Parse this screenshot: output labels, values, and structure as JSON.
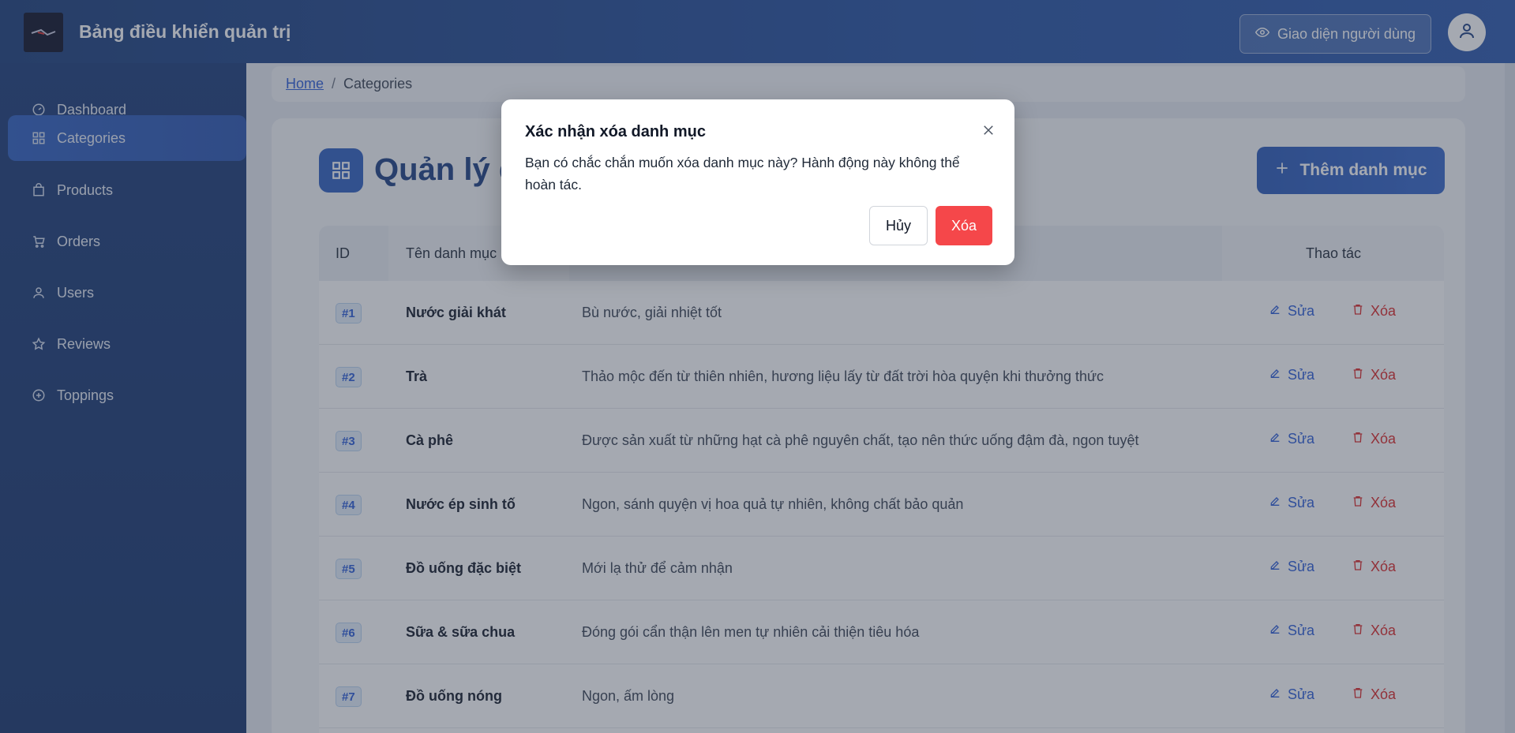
{
  "header": {
    "title": "Bảng điều khiển quản trị",
    "user_view_label": "Giao diện người dùng"
  },
  "sidebar": {
    "items": [
      {
        "label": "Dashboard",
        "icon": "gauge-icon"
      },
      {
        "label": "Categories",
        "icon": "grid-icon",
        "active": true
      },
      {
        "label": "Products",
        "icon": "bag-icon"
      },
      {
        "label": "Orders",
        "icon": "cart-icon"
      },
      {
        "label": "Users",
        "icon": "user-icon"
      },
      {
        "label": "Reviews",
        "icon": "star-icon"
      },
      {
        "label": "Toppings",
        "icon": "plus-circle-icon"
      }
    ]
  },
  "breadcrumb": {
    "home": "Home",
    "separator": "/",
    "current": "Categories"
  },
  "page": {
    "title": "Quản lý danh mục",
    "add_label": "Thêm danh mục"
  },
  "table": {
    "headers": {
      "id": "ID",
      "name": "Tên danh mục",
      "actions": "Thao tác"
    },
    "edit_label": "Sửa",
    "delete_label": "Xóa",
    "rows": [
      {
        "id": "#1",
        "name": "Nước giải khát",
        "desc": "Bù nước, giải nhiệt tốt"
      },
      {
        "id": "#2",
        "name": "Trà",
        "desc": "Thảo mộc đến từ thiên nhiên, hương liệu lấy từ đất trời hòa quyện khi thưởng thức"
      },
      {
        "id": "#3",
        "name": "Cà phê",
        "desc": "Được sản xuất từ những hạt cà phê nguyên chất, tạo nên thức uống đậm đà, ngon tuyệt"
      },
      {
        "id": "#4",
        "name": "Nước ép sinh tố",
        "desc": "Ngon, sánh quyện vị hoa quả tự nhiên, không chất bảo quản"
      },
      {
        "id": "#5",
        "name": "Đồ uống đặc biệt",
        "desc": "Mới lạ thử để cảm nhận"
      },
      {
        "id": "#6",
        "name": "Sữa & sữa chua",
        "desc": "Đóng gói cẩn thận lên men tự nhiên cải thiện tiêu hóa"
      },
      {
        "id": "#7",
        "name": "Đồ uống nóng",
        "desc": "Ngon, ấm lòng"
      }
    ]
  },
  "modal": {
    "title": "Xác nhận xóa danh mục",
    "body": "Bạn có chắc chắn muốn xóa danh mục này? Hành động này không thể hoàn tác.",
    "cancel_label": "Hủy",
    "confirm_label": "Xóa"
  },
  "colors": {
    "brand": "#2a58ad",
    "danger": "#f5474a",
    "link": "#2a5bd7"
  }
}
